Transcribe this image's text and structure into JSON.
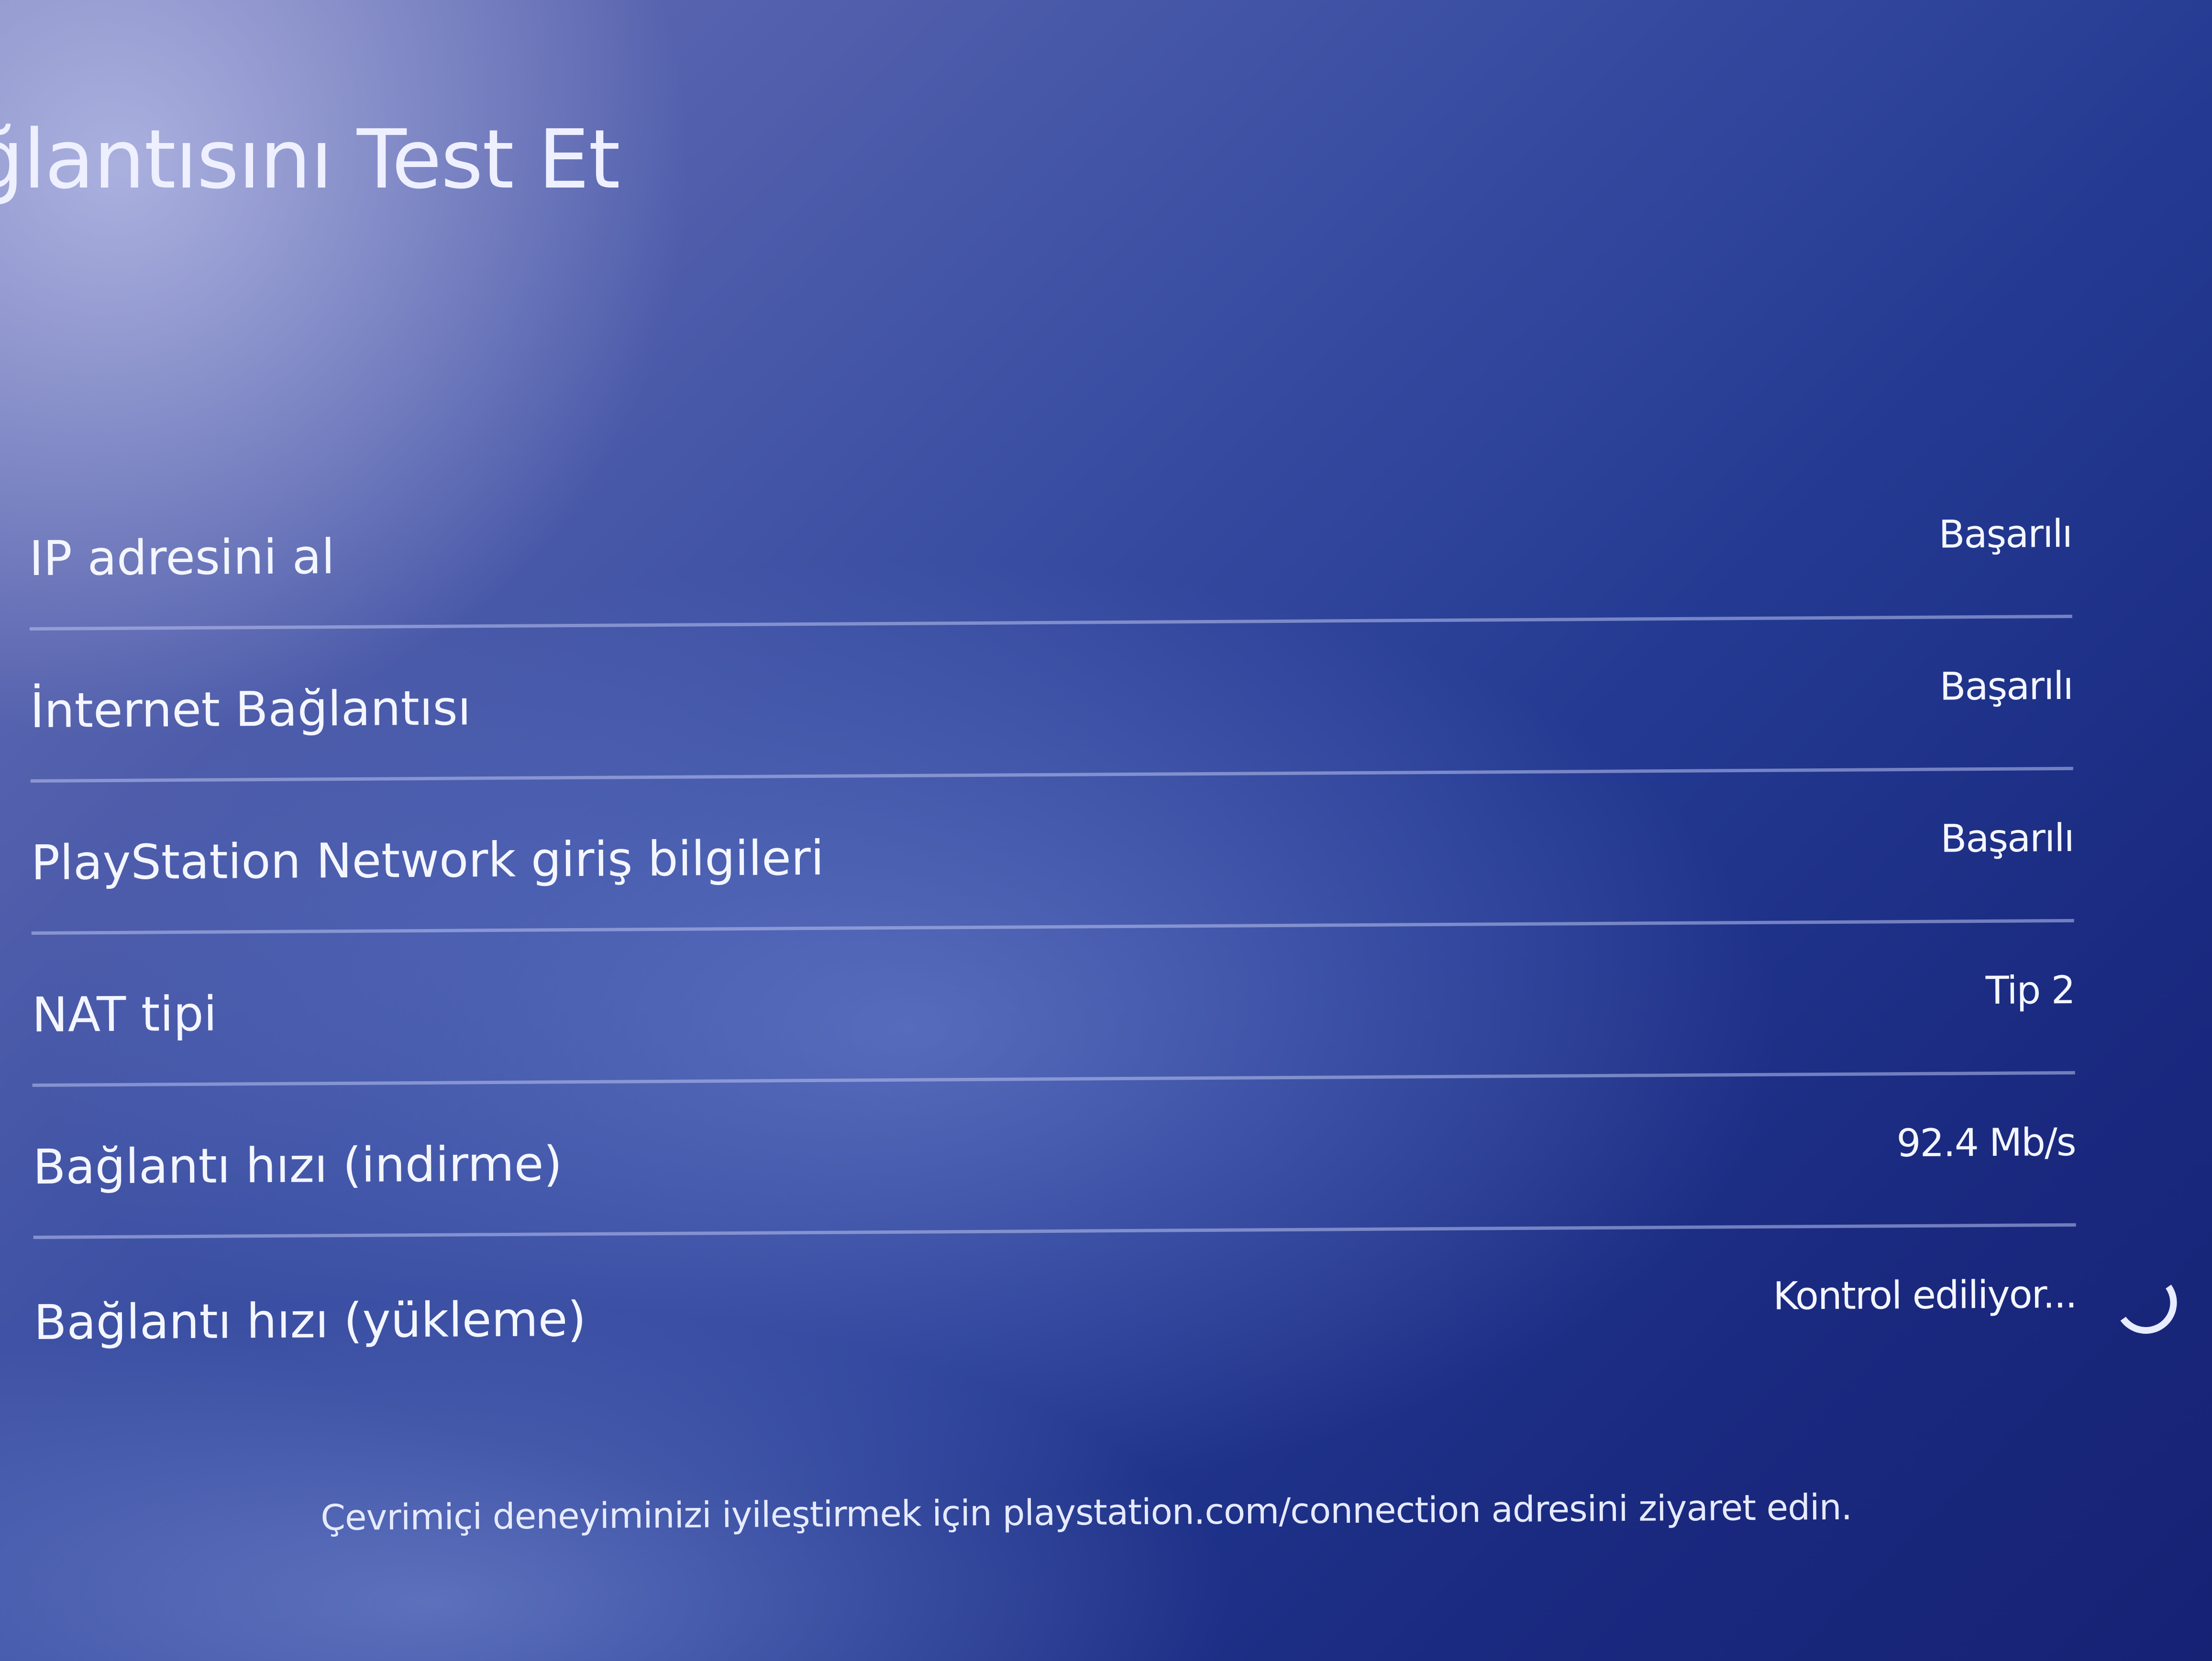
{
  "header": {
    "title": "ağlantısını Test Et"
  },
  "results": [
    {
      "label": "IP adresini al",
      "value": "Başarılı"
    },
    {
      "label": "İnternet Bağlantısı",
      "value": "Başarılı"
    },
    {
      "label": "PlayStation Network giriş bilgileri",
      "value": "Başarılı"
    },
    {
      "label": "NAT tipi",
      "value": "Tip 2"
    },
    {
      "label": "Bağlantı hızı (indirme)",
      "value": "92.4 Mb/s"
    },
    {
      "label": "Bağlantı hızı (yükleme)",
      "value": "Kontrol ediliyor..."
    }
  ],
  "footer": {
    "text": "Çevrimiçi deneyiminizi iyileştirmek için playstation.com/connection adresini ziyaret edin."
  },
  "icons": {
    "loading": "loading-spinner-icon"
  }
}
